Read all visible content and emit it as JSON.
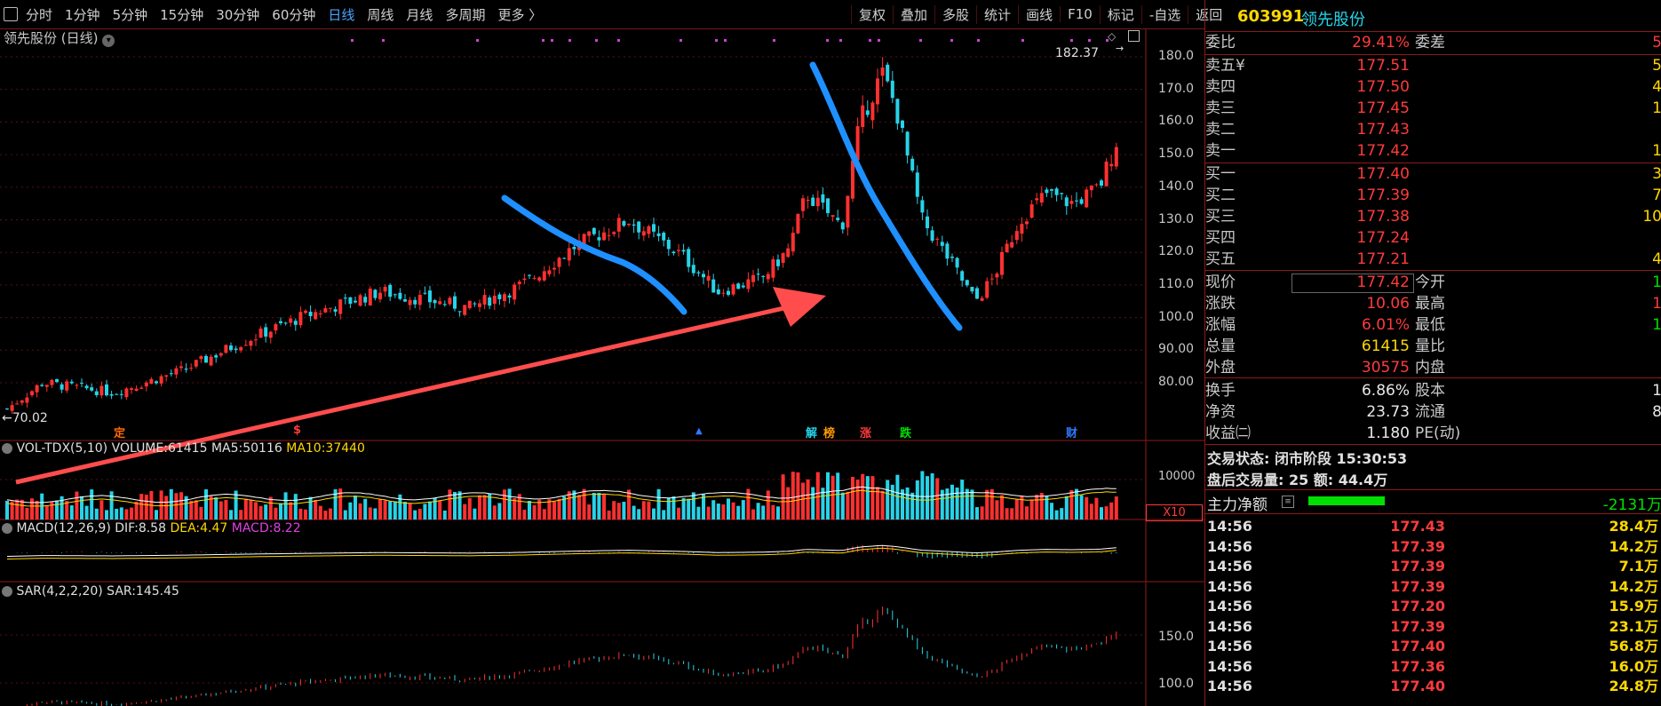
{
  "toolbar": {
    "periods": [
      "分时",
      "1分钟",
      "5分钟",
      "15分钟",
      "30分钟",
      "60分钟",
      "日线",
      "周线",
      "月线",
      "多周期",
      "更多 〉"
    ],
    "active_period": "日线",
    "tools": [
      "复权",
      "叠加",
      "多股",
      "统计",
      "画线",
      "F10",
      "标记",
      "-自选",
      "返回"
    ]
  },
  "chart": {
    "title": "领先股份 (日线)",
    "high_label": "182.37",
    "low_label": "←70.02",
    "price_ticks": [
      "180.0",
      "170.0",
      "160.0",
      "150.0",
      "140.0",
      "130.0",
      "120.0",
      "110.0",
      "100.0",
      "90.00",
      "80.00"
    ],
    "event_markers": [
      {
        "text": "定",
        "color": "#ff6a00"
      },
      {
        "text": "$",
        "color": "#ff3b3b"
      },
      {
        "text": "▲",
        "color": "#2d7bff"
      },
      {
        "text": "解",
        "color": "#27d3e8"
      },
      {
        "text": "榜",
        "color": "#ff9a00"
      },
      {
        "text": "涨",
        "color": "#ff3b3b"
      },
      {
        "text": "跌",
        "color": "#00e000"
      },
      {
        "text": "财",
        "color": "#2d7bff"
      }
    ],
    "volume": {
      "name": "VOL-TDX(5,10)",
      "volume_label": "VOLUME:",
      "volume_value": "61415",
      "ma5_label": "MA5:",
      "ma5_value": "50116",
      "ma10_label": "MA10:",
      "ma10_value": "37440",
      "tick": "10000",
      "multiplier": "X10"
    },
    "macd": {
      "name": "MACD(12,26,9)",
      "dif_label": "DIF:",
      "dif_value": "8.58",
      "dea_label": "DEA:",
      "dea_value": "4.47",
      "macd_label": "MACD:",
      "macd_value": "8.22"
    },
    "sar": {
      "name": "SAR(4,2,2,20)",
      "sar_label": "SAR:",
      "sar_value": "145.45",
      "ticks": [
        "150.0",
        "100.0"
      ]
    }
  },
  "quote": {
    "code": "603991",
    "name": "领先股份",
    "weibi_label": "委比",
    "weibi_value": "29.41%",
    "weicha_label": "委差",
    "weicha_value": "5",
    "asks": [
      {
        "label": "卖五¥",
        "price": "177.51",
        "vol": "5"
      },
      {
        "label": "卖四",
        "price": "177.50",
        "vol": "4"
      },
      {
        "label": "卖三",
        "price": "177.45",
        "vol": "1"
      },
      {
        "label": "卖二",
        "price": "177.43",
        "vol": ""
      },
      {
        "label": "卖一",
        "price": "177.42",
        "vol": "1"
      }
    ],
    "bids": [
      {
        "label": "买一",
        "price": "177.40",
        "vol": "3"
      },
      {
        "label": "买二",
        "price": "177.39",
        "vol": "7"
      },
      {
        "label": "买三",
        "price": "177.38",
        "vol": "10"
      },
      {
        "label": "买四",
        "price": "177.24",
        "vol": ""
      },
      {
        "label": "买五",
        "price": "177.21",
        "vol": "4"
      }
    ],
    "stats1": [
      {
        "l1": "现价",
        "v1": "177.42",
        "c1": "red",
        "l2": "今开",
        "v2": "1",
        "c2": "green"
      },
      {
        "l1": "涨跌",
        "v1": "10.06",
        "c1": "red",
        "l2": "最高",
        "v2": "1",
        "c2": "red"
      },
      {
        "l1": "涨幅",
        "v1": "6.01%",
        "c1": "red",
        "l2": "最低",
        "v2": "1",
        "c2": "green"
      },
      {
        "l1": "总量",
        "v1": "61415",
        "c1": "yellow",
        "l2": "量比",
        "v2": "",
        "c2": "white"
      },
      {
        "l1": "外盘",
        "v1": "30575",
        "c1": "red",
        "l2": "内盘",
        "v2": "",
        "c2": "white"
      }
    ],
    "stats2": [
      {
        "l1": "换手",
        "v1": "6.86%",
        "l2": "股本",
        "v2": "1"
      },
      {
        "l1": "净资",
        "v1": "23.73",
        "l2": "流通",
        "v2": "8"
      },
      {
        "l1": "收益㈡",
        "v1": "1.180",
        "l2": "PE(动)",
        "v2": ""
      }
    ],
    "status_line": "交易状态: 闭市阶段 15:30:53",
    "after_line": "盘后交易量: 25  额: 44.4万",
    "main_flow_label": "主力净额",
    "main_flow_value": "-2131万",
    "ticks": [
      {
        "t": "14:56",
        "p": "177.43",
        "v": "28.4万"
      },
      {
        "t": "14:56",
        "p": "177.39",
        "v": "14.2万"
      },
      {
        "t": "14:56",
        "p": "177.39",
        "v": "7.1万"
      },
      {
        "t": "14:56",
        "p": "177.39",
        "v": "14.2万"
      },
      {
        "t": "14:56",
        "p": "177.20",
        "v": "15.9万"
      },
      {
        "t": "14:56",
        "p": "177.39",
        "v": "23.1万"
      },
      {
        "t": "14:56",
        "p": "177.40",
        "v": "56.8万"
      },
      {
        "t": "14:56",
        "p": "177.36",
        "v": "16.0万"
      },
      {
        "t": "14:56",
        "p": "177.40",
        "v": "24.8万"
      }
    ]
  }
}
